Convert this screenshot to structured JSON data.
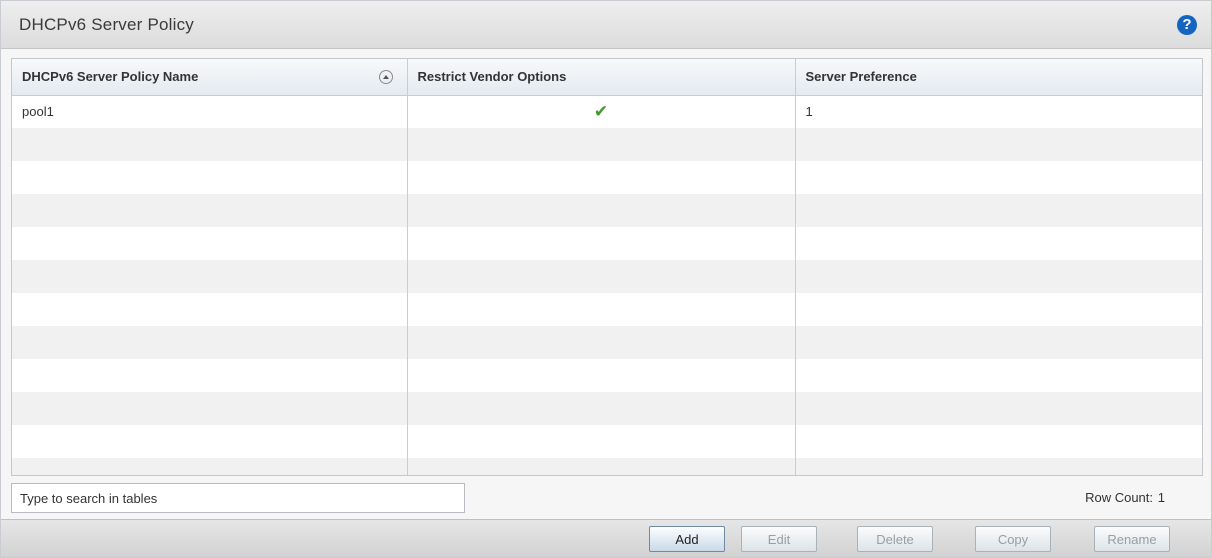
{
  "header": {
    "title": "DHCPv6 Server Policy",
    "help_label": "?"
  },
  "table": {
    "columns": [
      "DHCPv6 Server Policy Name",
      "Restrict Vendor Options",
      "Server Preference"
    ],
    "rows": [
      {
        "name": "pool1",
        "restrict_vendor_options": true,
        "server_preference": "1"
      }
    ]
  },
  "footer": {
    "search_placeholder": "Type to search in tables",
    "row_count_label": "Row Count:",
    "row_count_value": "1"
  },
  "buttons": {
    "add": "Add",
    "edit": "Edit",
    "delete": "Delete",
    "copy": "Copy",
    "rename": "Rename"
  },
  "icons": {
    "help": "help-icon",
    "sort": "sort-ascending-icon",
    "check": "checkmark-icon"
  },
  "colors": {
    "help_blue": "#1565c0",
    "check_green": "#3f9a2a"
  }
}
